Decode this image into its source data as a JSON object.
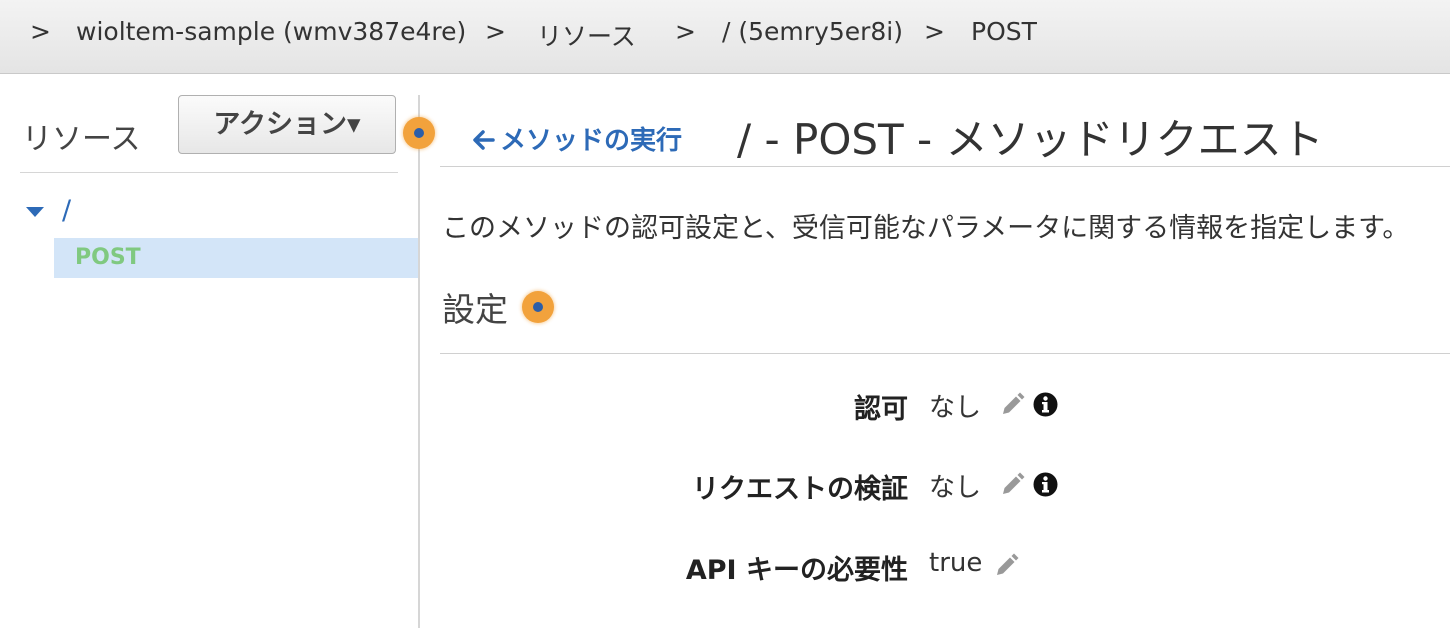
{
  "breadcrumb": {
    "separator": ">",
    "items": [
      {
        "label": "wioltem-sample (wmv387e4re)"
      },
      {
        "label": "リソース"
      },
      {
        "label": "/ (5emry5er8i)"
      },
      {
        "label": "POST"
      }
    ]
  },
  "sidebar": {
    "title": "リソース",
    "action_button": "アクション▾",
    "tree": {
      "root_label": "/",
      "children": [
        {
          "label": "POST",
          "selected": true
        }
      ]
    }
  },
  "main": {
    "back_link": "メソッドの実行",
    "title": "/ - POST - メソッドリクエスト",
    "description": "このメソッドの認可設定と、受信可能なパラメータに関する情報を指定します。",
    "section_title": "設定",
    "settings": [
      {
        "label": "認可",
        "value": "なし",
        "editable": true,
        "info": true
      },
      {
        "label": "リクエストの検証",
        "value": "なし",
        "editable": true,
        "info": true
      },
      {
        "label": "API キーの必要性",
        "value": "true",
        "editable": true,
        "info": false
      }
    ]
  },
  "colors": {
    "link_blue": "#2d6ab7",
    "selected_bg": "#d3e5f8",
    "post_green": "#80c980",
    "dot_orange": "#f2a23c"
  },
  "icons": [
    "arrow-left-icon",
    "pencil-icon",
    "info-icon",
    "caret-down-icon"
  ]
}
